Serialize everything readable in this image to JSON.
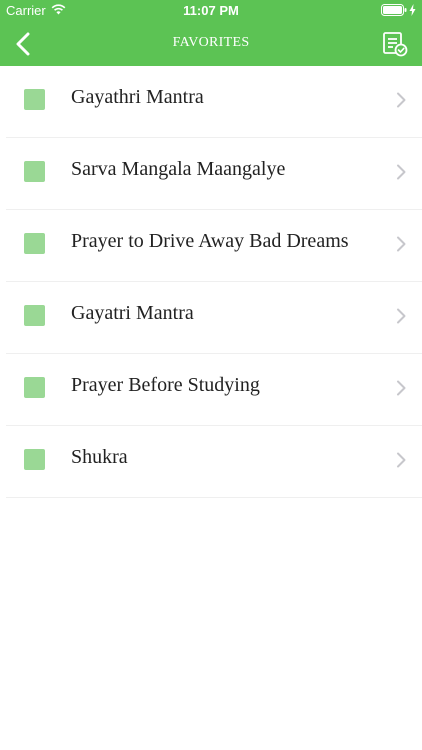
{
  "status_bar": {
    "carrier": "Carrier",
    "time": "11:07 PM",
    "icons": [
      "wifi-icon",
      "battery-icon",
      "charging-icon"
    ]
  },
  "nav": {
    "title": "FAVORITES",
    "back_icon": "chevron-left-icon",
    "action_icon": "favorites-list-icon"
  },
  "colors": {
    "accent": "#5cc354",
    "swatch": "#9ad895",
    "chevron": "#c7c7cc",
    "divider": "#efefef"
  },
  "favorites": [
    {
      "label": "Gayathri Mantra"
    },
    {
      "label": "Sarva Mangala Maangalye"
    },
    {
      "label": "Prayer to Drive Away Bad Dreams"
    },
    {
      "label": "Gayatri Mantra"
    },
    {
      "label": "Prayer Before Studying"
    },
    {
      "label": "Shukra"
    }
  ]
}
